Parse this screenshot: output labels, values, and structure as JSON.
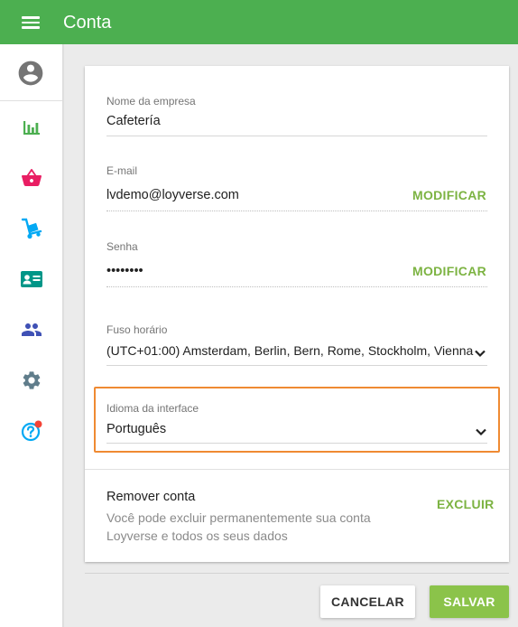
{
  "app_bar": {
    "title": "Conta"
  },
  "sidebar": {
    "items": [
      {
        "icon": "account-circle-icon",
        "color": "#757575"
      },
      {
        "icon": "bar-chart-icon",
        "color": "#4caf50"
      },
      {
        "icon": "basket-icon",
        "color": "#e91e63"
      },
      {
        "icon": "hand-truck-icon",
        "color": "#03a9f4"
      },
      {
        "icon": "contact-card-icon",
        "color": "#009688"
      },
      {
        "icon": "people-icon",
        "color": "#3f51b5"
      },
      {
        "icon": "gear-icon",
        "color": "#607d8b"
      },
      {
        "icon": "help-icon",
        "color": "#03a9f4",
        "badge_color": "#f44336"
      }
    ]
  },
  "form": {
    "company": {
      "label": "Nome da empresa",
      "value": "Cafetería"
    },
    "email": {
      "label": "E-mail",
      "value": "lvdemo@loyverse.com",
      "action": "MODIFICAR"
    },
    "password": {
      "label": "Senha",
      "value": "••••••••",
      "action": "MODIFICAR"
    },
    "timezone": {
      "label": "Fuso horário",
      "value": "(UTC+01:00) Amsterdam, Berlin, Bern, Rome, Stockholm, Vienna"
    },
    "language": {
      "label": "Idioma da interface",
      "value": "Português"
    }
  },
  "remove_account": {
    "title": "Remover conta",
    "description": "Você pode excluir permanentemente sua conta Loyverse e todos os seus dados",
    "action": "EXCLUIR"
  },
  "buttons": {
    "cancel": "CANCELAR",
    "save": "SALVAR"
  },
  "colors": {
    "primary": "#4caf50",
    "accent": "#7cb342",
    "highlight": "#ef8a32",
    "save_button": "#8bc34a"
  }
}
